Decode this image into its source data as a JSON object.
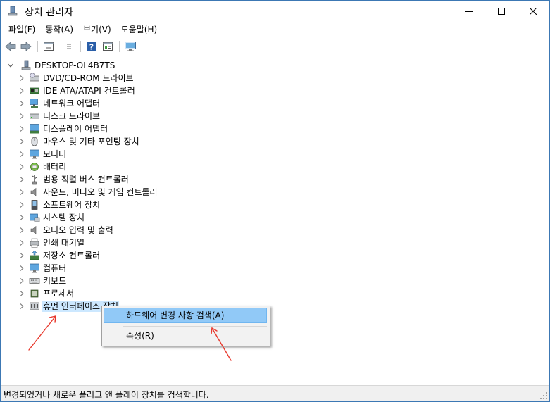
{
  "window": {
    "title": "장치 관리자",
    "accent": "#3c78b4"
  },
  "menu": [
    "파일(F)",
    "동작(A)",
    "보기(V)",
    "도움말(H)"
  ],
  "toolbar": [
    "back-icon",
    "forward-icon",
    "properties-view-icon",
    "details-view-icon",
    "help-icon",
    "update-driver-icon",
    "scan-monitor-icon"
  ],
  "tree": {
    "root": "DESKTOP-OL4B7TS",
    "items": [
      {
        "label": "DVD/CD-ROM 드라이브",
        "icon": "dvd-drive-icon"
      },
      {
        "label": "IDE ATA/ATAPI 컨트롤러",
        "icon": "ide-controller-icon"
      },
      {
        "label": "네트워크 어댑터",
        "icon": "network-adapter-icon"
      },
      {
        "label": "디스크 드라이브",
        "icon": "disk-drive-icon"
      },
      {
        "label": "디스플레이 어댑터",
        "icon": "display-adapter-icon"
      },
      {
        "label": "마우스 및 기타 포인팅 장치",
        "icon": "mouse-icon"
      },
      {
        "label": "모니터",
        "icon": "monitor-icon"
      },
      {
        "label": "배터리",
        "icon": "battery-icon"
      },
      {
        "label": "범용 직렬 버스 컨트롤러",
        "icon": "usb-icon"
      },
      {
        "label": "사운드, 비디오 및 게임 컨트롤러",
        "icon": "speaker-icon"
      },
      {
        "label": "소프트웨어 장치",
        "icon": "software-device-icon"
      },
      {
        "label": "시스템 장치",
        "icon": "system-device-icon"
      },
      {
        "label": "오디오 입력 및 출력",
        "icon": "audio-io-icon"
      },
      {
        "label": "인쇄 대기열",
        "icon": "printer-icon"
      },
      {
        "label": "저장소 컨트롤러",
        "icon": "storage-controller-icon"
      },
      {
        "label": "컴퓨터",
        "icon": "computer-icon"
      },
      {
        "label": "키보드",
        "icon": "keyboard-icon"
      },
      {
        "label": "프로세서",
        "icon": "processor-icon"
      },
      {
        "label": "휴먼 인터페이스 장치",
        "icon": "hid-icon"
      }
    ]
  },
  "context_menu": {
    "scan_label": "하드웨어 변경 사항 검색(A)",
    "properties_label": "속성(R)"
  },
  "status": {
    "text": "변경되었거나 새로운 플러그 앤 플레이 장치를 검색합니다."
  },
  "colors": {
    "selection": "#cce8ff",
    "menu_hover": "#91c9f7",
    "annotation_arrow": "#e8382c"
  }
}
